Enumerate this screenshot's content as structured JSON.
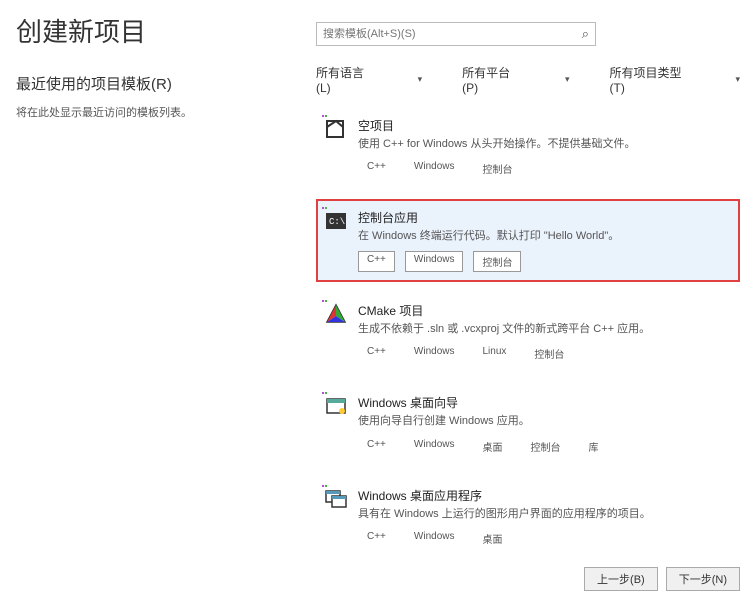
{
  "header": {
    "page_title": "创建新项目"
  },
  "recent": {
    "title": "最近使用的项目模板(R)",
    "desc": "将在此处显示最近访问的模板列表。"
  },
  "search": {
    "placeholder": "搜索模板(Alt+S)(S)"
  },
  "filters": {
    "language": "所有语言(L)",
    "platform": "所有平台(P)",
    "project_type": "所有项目类型(T)"
  },
  "templates": [
    {
      "title": "空项目",
      "desc": "使用 C++ for Windows 从头开始操作。不提供基础文件。",
      "tags": [
        "C++",
        "Windows",
        "控制台"
      ],
      "selected": false,
      "icon": "empty"
    },
    {
      "title": "控制台应用",
      "desc": "在 Windows 终端运行代码。默认打印 \"Hello World\"。",
      "tags": [
        "C++",
        "Windows",
        "控制台"
      ],
      "selected": true,
      "icon": "console"
    },
    {
      "title": "CMake 项目",
      "desc": "生成不依赖于 .sln 或 .vcxproj 文件的新式跨平台 C++ 应用。",
      "tags": [
        "C++",
        "Windows",
        "Linux",
        "控制台"
      ],
      "selected": false,
      "icon": "cmake"
    },
    {
      "title": "Windows 桌面向导",
      "desc": "使用向导自行创建 Windows 应用。",
      "tags": [
        "C++",
        "Windows",
        "桌面",
        "控制台",
        "库"
      ],
      "selected": false,
      "icon": "wizard"
    },
    {
      "title": "Windows 桌面应用程序",
      "desc": "具有在 Windows 上运行的图形用户界面的应用程序的项目。",
      "tags": [
        "C++",
        "Windows",
        "桌面"
      ],
      "selected": false,
      "icon": "winapp"
    }
  ],
  "footer": {
    "back": "上一步(B)",
    "next": "下一步(N)"
  }
}
